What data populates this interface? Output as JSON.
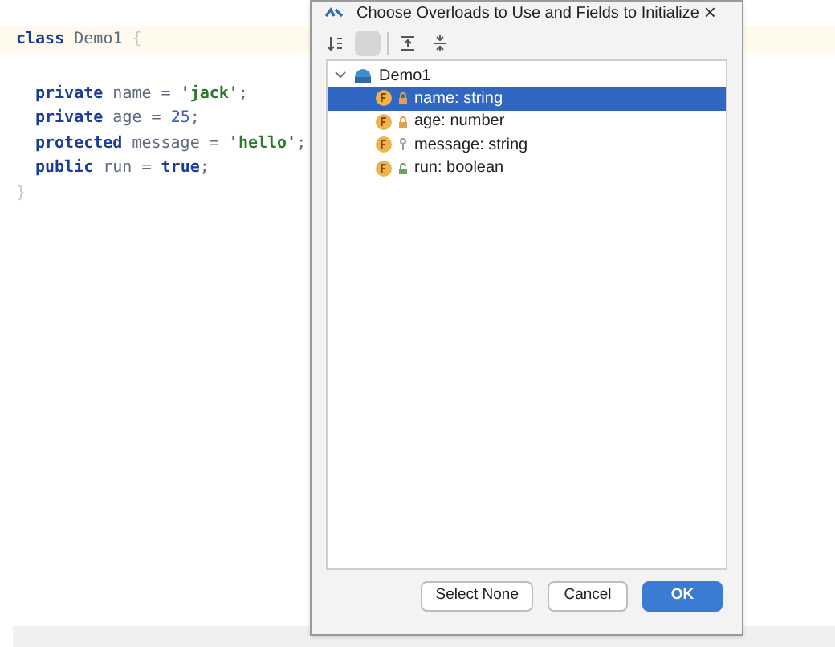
{
  "editor": {
    "lines": [
      [
        {
          "kind": "keyword",
          "text": "class"
        },
        {
          "kind": "plain",
          "text": " Demo1 "
        },
        {
          "kind": "brace",
          "text": "{"
        }
      ],
      [
        {
          "kind": "keyword",
          "text": "private"
        },
        {
          "kind": "plain",
          "text": " name = "
        },
        {
          "kind": "string",
          "text": "'jack'"
        },
        {
          "kind": "plain",
          "text": ";"
        }
      ],
      [
        {
          "kind": "keyword",
          "text": "private"
        },
        {
          "kind": "plain",
          "text": " age = "
        },
        {
          "kind": "number",
          "text": "25"
        },
        {
          "kind": "plain",
          "text": ";"
        }
      ],
      [
        {
          "kind": "keyword",
          "text": "protected"
        },
        {
          "kind": "plain",
          "text": " message = "
        },
        {
          "kind": "string",
          "text": "'hello'"
        },
        {
          "kind": "plain",
          "text": ";"
        }
      ],
      [
        {
          "kind": "keyword",
          "text": "public"
        },
        {
          "kind": "plain",
          "text": " run = "
        },
        {
          "kind": "keyword",
          "text": "true"
        },
        {
          "kind": "plain",
          "text": ";"
        }
      ],
      [
        {
          "kind": "brace",
          "text": "}"
        }
      ]
    ]
  },
  "dialog": {
    "title": "Choose Overloads to Use and Fields to Initialize",
    "close": "×",
    "toolbar": [
      {
        "kind": "sort",
        "selected": false
      },
      {
        "kind": "blank",
        "selected": true
      },
      {
        "kind": "expand",
        "selected": false
      },
      {
        "kind": "collapse",
        "selected": false
      }
    ],
    "tree": {
      "label": "Demo1",
      "expanded": true,
      "children": [
        {
          "label": "name: string",
          "kind": "private",
          "selected": true
        },
        {
          "label": "age: number",
          "kind": "private",
          "selected": false
        },
        {
          "label": "message: string",
          "kind": "protected",
          "selected": false
        },
        {
          "label": "run: boolean",
          "kind": "public",
          "selected": false
        }
      ]
    },
    "buttons": [
      {
        "label": "Select None",
        "kind": "normal"
      },
      {
        "label": "Cancel",
        "kind": "normal"
      },
      {
        "label": "OK",
        "kind": "primary"
      }
    ]
  }
}
